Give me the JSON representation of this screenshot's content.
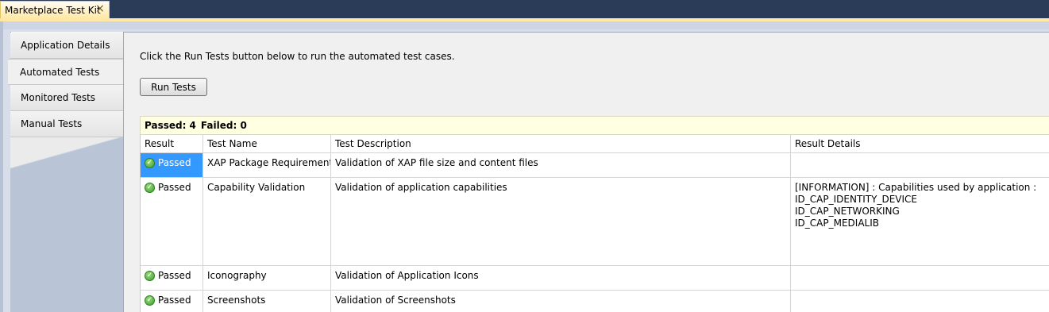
{
  "window": {
    "tab_title": "Marketplace Test Kit",
    "close_glyph": "×"
  },
  "sidebar": {
    "items": [
      {
        "label": "Application Details",
        "active": false
      },
      {
        "label": "Automated Tests",
        "active": true
      },
      {
        "label": "Monitored Tests",
        "active": false
      },
      {
        "label": "Manual Tests",
        "active": false
      }
    ]
  },
  "main": {
    "instruction": "Click the Run Tests button below to run the automated test cases.",
    "run_button_label": "Run Tests",
    "summary": {
      "passed": "Passed: 4",
      "failed": "Failed: 0"
    },
    "table": {
      "headers": [
        "Result",
        "Test Name",
        "Test Description",
        "Result Details"
      ],
      "rows": [
        {
          "result": "Passed",
          "name": "XAP Package Requirements",
          "description": "Validation of XAP file size and content files",
          "details": [
            "",
            "",
            "",
            ""
          ],
          "selected": true
        },
        {
          "result": "Passed",
          "name": "Capability Validation",
          "description": "Validation of application capabilities",
          "details": [
            "[INFORMATION] : Capabilities used by application :",
            "ID_CAP_IDENTITY_DEVICE",
            "ID_CAP_NETWORKING",
            "ID_CAP_MEDIALIB"
          ],
          "selected": false
        },
        {
          "result": "Passed",
          "name": "Iconography",
          "description": "Validation of Application Icons",
          "details": [
            "",
            "",
            "",
            ""
          ],
          "selected": false
        },
        {
          "result": "Passed",
          "name": "Screenshots",
          "description": "Validation of Screenshots",
          "details": [
            "",
            "",
            "",
            ""
          ],
          "selected": false
        }
      ]
    }
  },
  "colors": {
    "selection": "#3399ff",
    "summary_bg": "#ffffe1",
    "passed_icon": "#3a9a2a"
  },
  "icons": {
    "passed": "check-circle-icon"
  }
}
